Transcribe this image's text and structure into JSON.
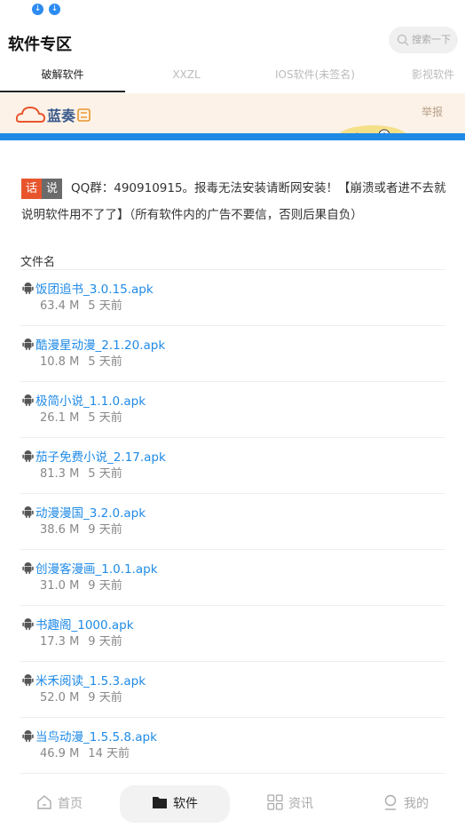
{
  "header": {
    "title": "软件专区",
    "search_placeholder": "搜索一下"
  },
  "tabs": [
    {
      "label": "破解软件",
      "active": true
    },
    {
      "label": "XXZL",
      "active": false
    },
    {
      "label": "IOS软件(未签名)",
      "active": false
    },
    {
      "label": "影视软件",
      "active": false
    }
  ],
  "banner": {
    "brand": "蓝奏",
    "report": "举报"
  },
  "notice": {
    "badge1": "话",
    "badge2": "说",
    "text": "QQ群：490910915。报毒无法安装请断网安装！【崩溃或者进不去就说明软件用不了了】（所有软件内的广告不要信，否则后果自负）"
  },
  "file_list": {
    "header": "文件名",
    "items": [
      {
        "name": "饭团追书_3.0.15.apk",
        "size": "63.4 M",
        "time": "5 天前"
      },
      {
        "name": "酷漫星动漫_2.1.20.apk",
        "size": "10.8 M",
        "time": "5 天前"
      },
      {
        "name": "极简小说_1.1.0.apk",
        "size": "26.1 M",
        "time": "5 天前"
      },
      {
        "name": "茄子免费小说_2.17.apk",
        "size": "81.3 M",
        "time": "5 天前"
      },
      {
        "name": "动漫漫国_3.2.0.apk",
        "size": "38.6 M",
        "time": "9 天前"
      },
      {
        "name": "创漫客漫画_1.0.1.apk",
        "size": "31.0 M",
        "time": "9 天前"
      },
      {
        "name": "书趣阁_1000.apk",
        "size": "17.3 M",
        "time": "9 天前"
      },
      {
        "name": "米禾阅读_1.5.3.apk",
        "size": "52.0 M",
        "time": "9 天前"
      },
      {
        "name": "当鸟动漫_1.5.5.8.apk",
        "size": "46.9 M",
        "time": "14 天前"
      }
    ]
  },
  "bottom_nav": [
    {
      "label": "首页",
      "icon": "home-icon",
      "active": false
    },
    {
      "label": "软件",
      "icon": "folder-icon",
      "active": true
    },
    {
      "label": "资讯",
      "icon": "grid-icon",
      "active": false
    },
    {
      "label": "我的",
      "icon": "user-icon",
      "active": false
    }
  ],
  "colors": {
    "accent": "#1f8ae6",
    "badge_red": "#e8552d",
    "banner_bg": "#fdf2e7"
  }
}
